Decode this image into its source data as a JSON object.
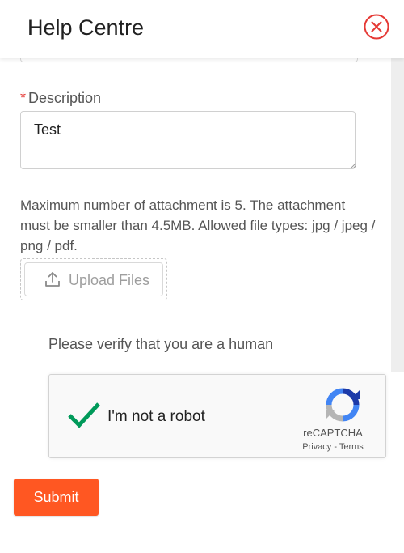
{
  "header": {
    "title": "Help Centre",
    "close_icon": "close-circle-icon",
    "accent_color": "#e53935"
  },
  "form": {
    "description": {
      "required_mark": "*",
      "label": "Description",
      "value": "Test"
    },
    "attachment_info": "Maximum number of attachment is 5. The attachment must be smaller than 4.5MB. Allowed file types: jpg / jpeg / png / pdf.",
    "upload": {
      "label": "Upload Files",
      "icon": "upload-icon"
    },
    "verify_prompt": "Please verify that you are a human",
    "recaptcha": {
      "label": "I'm not a robot",
      "checked": true,
      "brand": "reCAPTCHA",
      "privacy": "Privacy",
      "separator": " - ",
      "terms": "Terms"
    },
    "submit": {
      "label": "Submit",
      "color": "#ff5722"
    }
  }
}
